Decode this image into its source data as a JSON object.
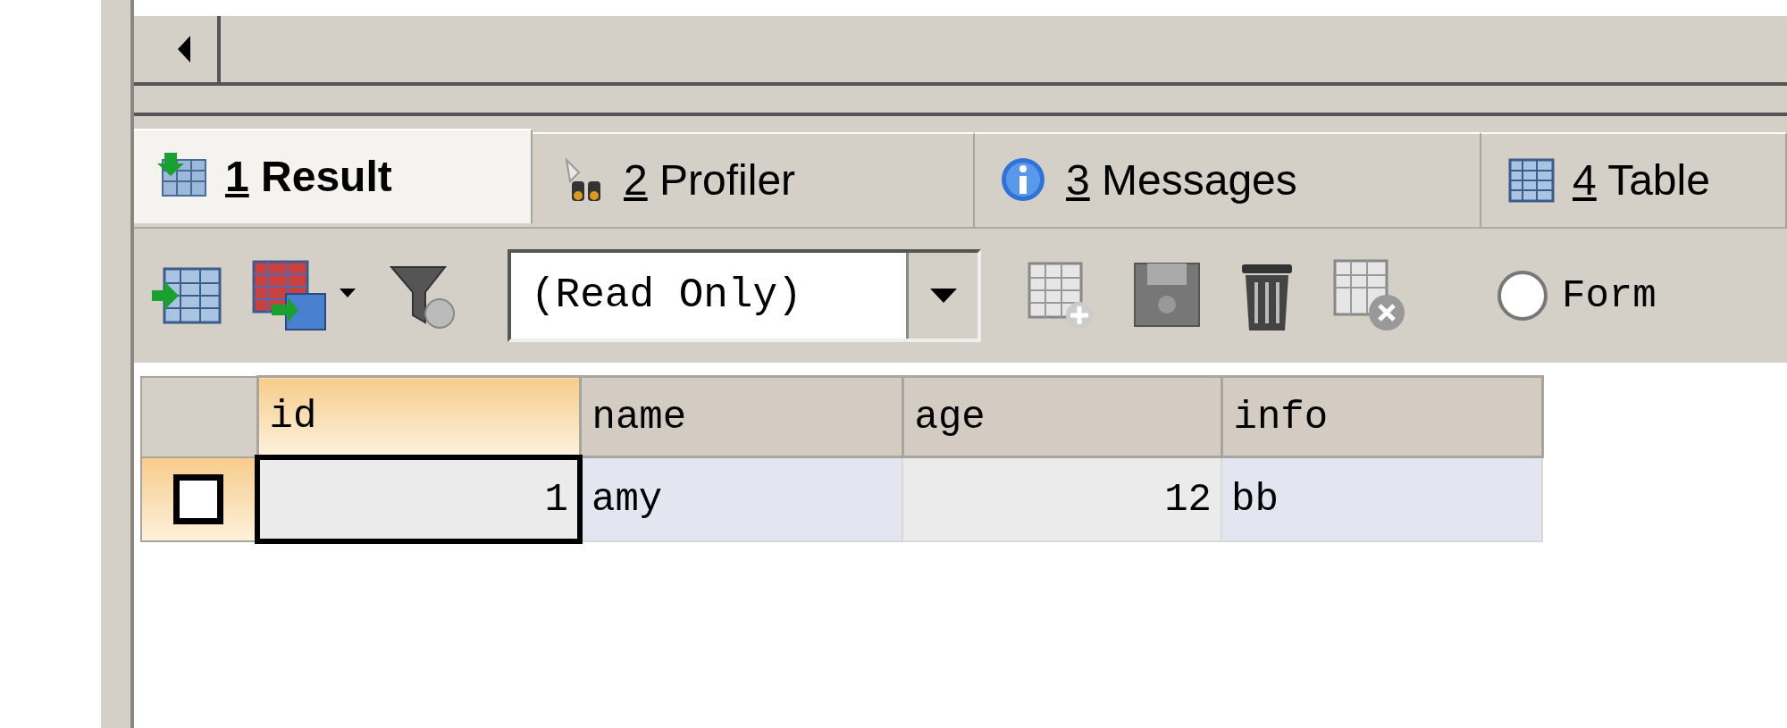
{
  "tabs": [
    {
      "number": "1",
      "label": "Result",
      "kind": "result",
      "selected": true
    },
    {
      "number": "2",
      "label": "Profiler",
      "kind": "profiler",
      "selected": false
    },
    {
      "number": "3",
      "label": "Messages",
      "kind": "messages",
      "selected": false
    },
    {
      "number": "4",
      "label": "Table",
      "kind": "table",
      "selected": false
    }
  ],
  "toolbar": {
    "mode": "(Read Only)",
    "form_option": {
      "label": "Form",
      "selected": false
    }
  },
  "grid": {
    "columns": [
      {
        "label": "id",
        "kind": "number",
        "selected": true
      },
      {
        "label": "name",
        "kind": "text",
        "selected": false
      },
      {
        "label": "age",
        "kind": "number",
        "selected": false
      },
      {
        "label": "info",
        "kind": "text",
        "selected": false
      }
    ],
    "rows": [
      {
        "checked": false,
        "current": true,
        "cells": [
          "1",
          "amy",
          "12",
          "bb"
        ]
      }
    ]
  }
}
